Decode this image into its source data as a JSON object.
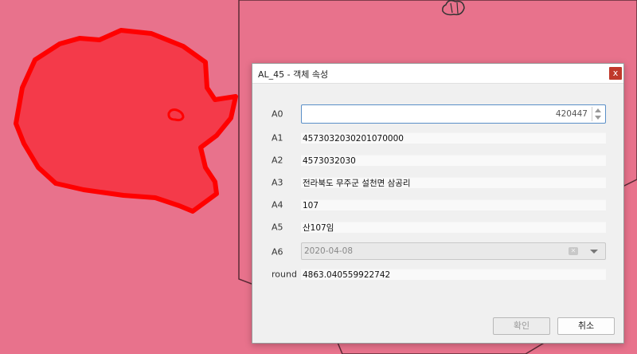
{
  "colors": {
    "map_background": "#e8728c",
    "feature_fill": "#f43a4a",
    "feature_outline": "#ff0000"
  },
  "dialog": {
    "title": "AL_45 - 객체 속성",
    "close_icon": "close-icon",
    "fields": [
      {
        "label": "A0",
        "value": "420447",
        "widget": "spinbox"
      },
      {
        "label": "A1",
        "value": "4573032030201070000",
        "widget": "text"
      },
      {
        "label": "A2",
        "value": "4573032030",
        "widget": "text"
      },
      {
        "label": "A3",
        "value": "전라북도 무주군 설천면 삼공리",
        "widget": "text"
      },
      {
        "label": "A4",
        "value": "107",
        "widget": "text"
      },
      {
        "label": "A5",
        "value": "산107임",
        "widget": "text"
      },
      {
        "label": "A6",
        "value": "2020-04-08",
        "widget": "date"
      },
      {
        "label": "round",
        "value": "4863.040559922742",
        "widget": "text"
      }
    ],
    "ok_label": "확인",
    "cancel_label": "취소"
  }
}
